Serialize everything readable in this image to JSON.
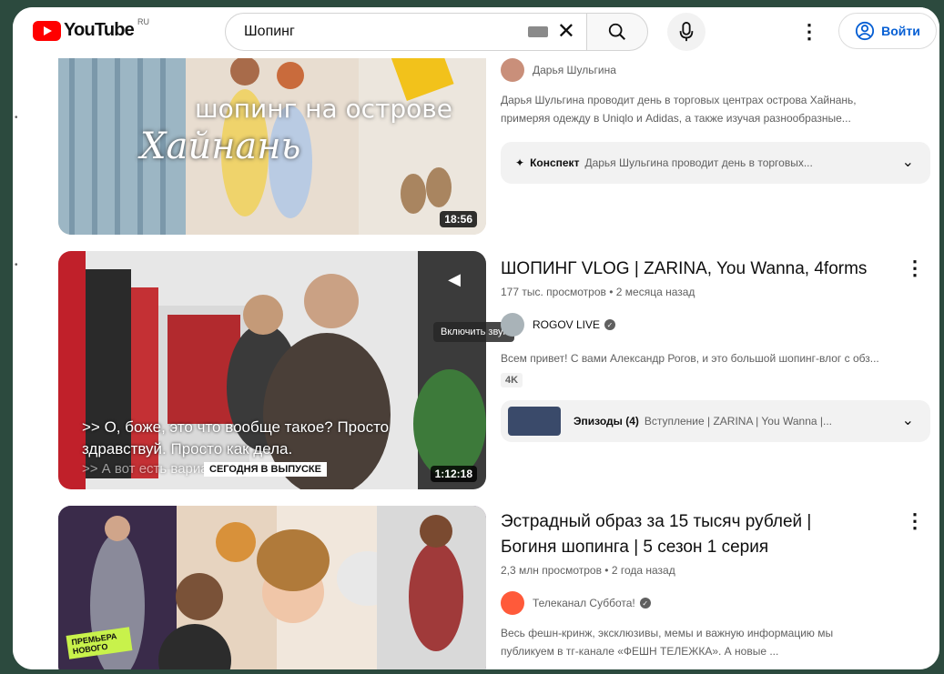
{
  "header": {
    "logo_text": "YouTube",
    "logo_country": "RU",
    "search_value": "Шопинг",
    "signin_label": "Войти"
  },
  "results": [
    {
      "thumb_text_1": "шопинг на острове",
      "thumb_text_2": "Хайнань",
      "duration": "18:56",
      "channel": "Дарья Шульгина",
      "desc_1": "Дарья Шульгина проводит день в торговых центрах острова Хайнань,",
      "desc_2": "примеряя одежду в Uniqlo и Adidas, а также изучая разнообразные...",
      "summary_label": "Конспект",
      "summary_text": "Дарья Шульгина проводит день в торговых..."
    },
    {
      "title": "ШОПИНГ VLOG | ZARINA, You Wanna, 4forms",
      "views": "177 тыс. просмотров",
      "age": "2 месяца назад",
      "channel": "ROGOV LIVE",
      "desc": "Всем привет! С вами Александр Рогов, и это большой шопинг-влог с обз...",
      "badge": "4K",
      "episodes_label": "Эпизоды (4)",
      "episodes_text": "Вступление | ZARINA | You Wanna |...",
      "tooltip": "Включить звук",
      "caption_1": ">> О, боже, это что вообще такое? Просто",
      "caption_2": "здравствуй. Просто как дела.",
      "caption_3": ">> А вот есть вариант ещё вот это...",
      "caption_bar": "СЕГОДНЯ В ВЫПУСКЕ",
      "duration": "1:12:18"
    },
    {
      "title_1": "Эстрадный образ за 15 тысяч рублей |",
      "title_2": "Богиня шопинга | 5 сезон 1 серия",
      "views": "2,3 млн просмотров",
      "age": "2 года назад",
      "channel": "Телеканал Суббота!",
      "desc_1": "Весь фешн-кринж, эксклюзивы, мемы и важную информацию мы",
      "desc_2": "публикуем в тг-канале «ФЕШН ТЕЛЕЖКА». А новые ...",
      "sticker": "ПРЕМЬЕРА НОВОГО"
    }
  ],
  "separator": "•",
  "colors": {
    "accent_blue": "#065fd4",
    "brand_red": "#ff0000",
    "background": "#2c4a3e"
  },
  "icons": [
    "youtube-logo-icon",
    "keyboard-icon",
    "clear-icon",
    "search-icon",
    "mic-icon",
    "more-vert-icon",
    "account-icon",
    "sparkle-icon",
    "chevron-down-icon",
    "verified-icon",
    "mute-icon"
  ]
}
